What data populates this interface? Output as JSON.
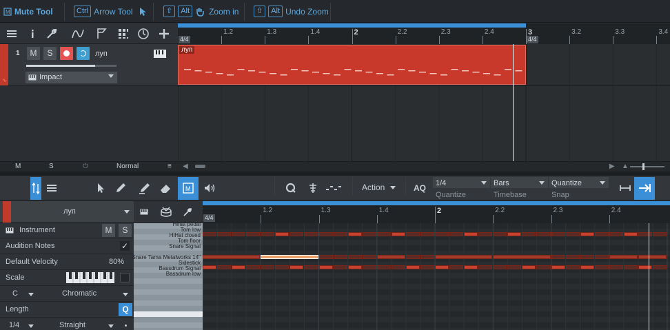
{
  "hintbar": {
    "tool_name": "Mute Tool",
    "hints": [
      {
        "keys": [
          "Ctrl"
        ],
        "label": "Arrow Tool",
        "icon": "arrow-cursor-icon"
      },
      {
        "keys": [
          "⇧",
          "Alt"
        ],
        "label": "Zoom in",
        "icon": "hand-zoom-icon"
      },
      {
        "keys": [
          "⇧",
          "Alt"
        ],
        "label": "Undo Zoom",
        "icon": ""
      }
    ]
  },
  "arranger": {
    "ruler_labels": [
      "1.2",
      "1.3",
      "1.4",
      "2",
      "2.2",
      "2.3",
      "2.4",
      "3",
      "3.2",
      "3.3",
      "3.4"
    ],
    "time_signature": "4/4",
    "track": {
      "number": "1",
      "mute": "M",
      "solo": "S",
      "name": "луп",
      "instrument": "Impact"
    },
    "clip_name": "луп",
    "bottom": {
      "mute": "M",
      "solo": "S",
      "mode": "Normal"
    }
  },
  "editor": {
    "action_label": "Action",
    "aq_label": "AQ",
    "quantize": {
      "value": "1/4",
      "label": "Quantize"
    },
    "timebase": {
      "value": "Bars",
      "label": "Timebase"
    },
    "snap": {
      "value": "Quantize",
      "label": "Snap"
    },
    "ruler_labels": [
      "1.2",
      "1.3",
      "1.4",
      "2",
      "2.2",
      "2.3",
      "2.4"
    ],
    "time_signature": "4/4",
    "inspector": {
      "track_name": "луп",
      "instrument_label": "Instrument",
      "mute": "M",
      "solo": "S",
      "audition_notes_label": "Audition Notes",
      "default_velocity_label": "Default Velocity",
      "default_velocity_value": "80%",
      "scale_label": "Scale",
      "scale_root": "C",
      "scale_type": "Chromatic",
      "length_label": "Length",
      "length_value": "1/4",
      "length_mode": "Straight",
      "quantize_btn": "Q"
    },
    "drum_names": [
      "Hihat pedal",
      "Tom low",
      "HiHat closed",
      "Tom floor",
      "Snare Signal",
      "Snare Tama Metalworks 14\"",
      "Sidestick",
      "Bassdrum Signal",
      "Bassdrum low"
    ]
  },
  "colors": {
    "accent_blue": "#3a8fd6",
    "clip_red": "#c9392b",
    "record_red": "#e55252"
  }
}
